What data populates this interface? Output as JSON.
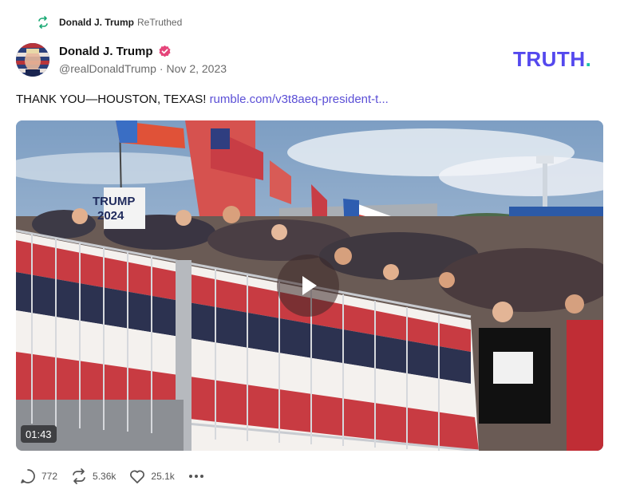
{
  "retruth": {
    "name": "Donald J. Trump",
    "label": "ReTruthed"
  },
  "author": {
    "name": "Donald J. Trump",
    "handle": "@realDonaldTrump",
    "separator": "·",
    "date": "Nov 2, 2023"
  },
  "brand": {
    "logo_text": "TRUTH.",
    "color": "#5448ee",
    "dot_color": "#19c3a8"
  },
  "post": {
    "text": "THANK YOU—HOUSTON, TEXAS!",
    "link_text": "rumble.com/v3t8aeq-president-t..."
  },
  "video": {
    "duration": "01:43",
    "sign_line1": "TRUMP",
    "sign_line2": "2024"
  },
  "actions": {
    "replies": "772",
    "retruths": "5.36k",
    "likes": "25.1k"
  }
}
